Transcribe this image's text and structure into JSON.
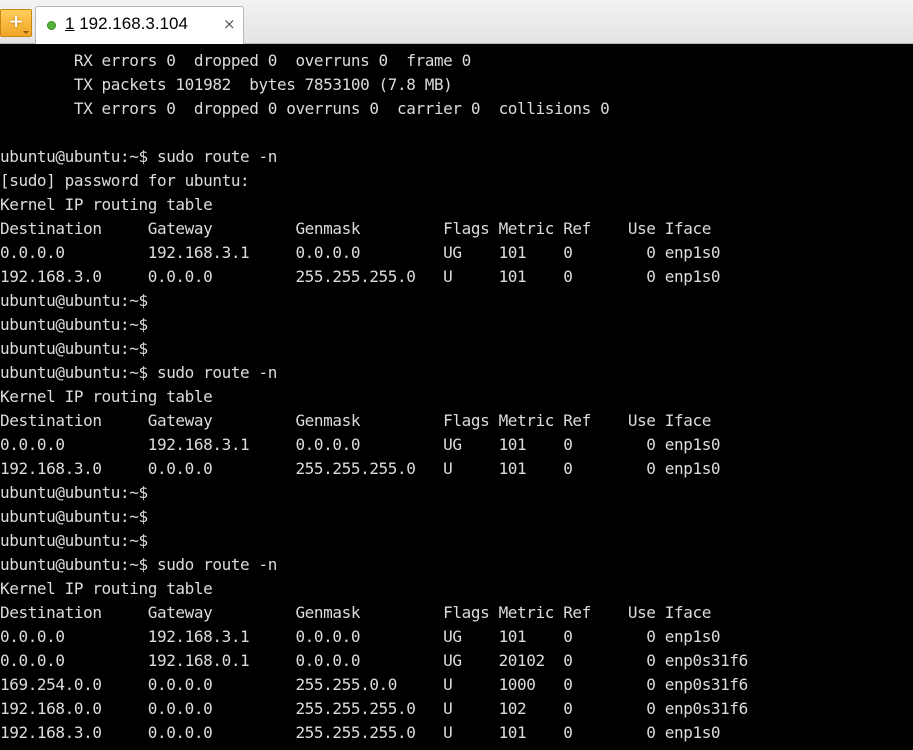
{
  "tabbar": {
    "new_tab_icon": "plus-icon",
    "tab": {
      "number": "1",
      "title": " 192.168.3.104",
      "status_color": "#56b33a",
      "close_glyph": "×"
    }
  },
  "terminal": {
    "text_color": "#dcdcdc",
    "background": "#000000",
    "lines": [
      "        RX errors 0  dropped 0  overruns 0  frame 0",
      "        TX packets 101982  bytes 7853100 (7.8 MB)",
      "        TX errors 0  dropped 0 overruns 0  carrier 0  collisions 0",
      "",
      "ubuntu@ubuntu:~$ sudo route -n",
      "[sudo] password for ubuntu:",
      "Kernel IP routing table",
      "Destination     Gateway         Genmask         Flags Metric Ref    Use Iface",
      "0.0.0.0         192.168.3.1     0.0.0.0         UG    101    0        0 enp1s0",
      "192.168.3.0     0.0.0.0         255.255.255.0   U     101    0        0 enp1s0",
      "ubuntu@ubuntu:~$",
      "ubuntu@ubuntu:~$",
      "ubuntu@ubuntu:~$",
      "ubuntu@ubuntu:~$ sudo route -n",
      "Kernel IP routing table",
      "Destination     Gateway         Genmask         Flags Metric Ref    Use Iface",
      "0.0.0.0         192.168.3.1     0.0.0.0         UG    101    0        0 enp1s0",
      "192.168.3.0     0.0.0.0         255.255.255.0   U     101    0        0 enp1s0",
      "ubuntu@ubuntu:~$",
      "ubuntu@ubuntu:~$",
      "ubuntu@ubuntu:~$",
      "ubuntu@ubuntu:~$ sudo route -n",
      "Kernel IP routing table",
      "Destination     Gateway         Genmask         Flags Metric Ref    Use Iface",
      "0.0.0.0         192.168.3.1     0.0.0.0         UG    101    0        0 enp1s0",
      "0.0.0.0         192.168.0.1     0.0.0.0         UG    20102  0        0 enp0s31f6",
      "169.254.0.0     0.0.0.0         255.255.0.0     U     1000   0        0 enp0s31f6",
      "192.168.0.0     0.0.0.0         255.255.255.0   U     102    0        0 enp0s31f6",
      "192.168.3.0     0.0.0.0         255.255.255.0   U     101    0        0 enp1s0"
    ]
  }
}
